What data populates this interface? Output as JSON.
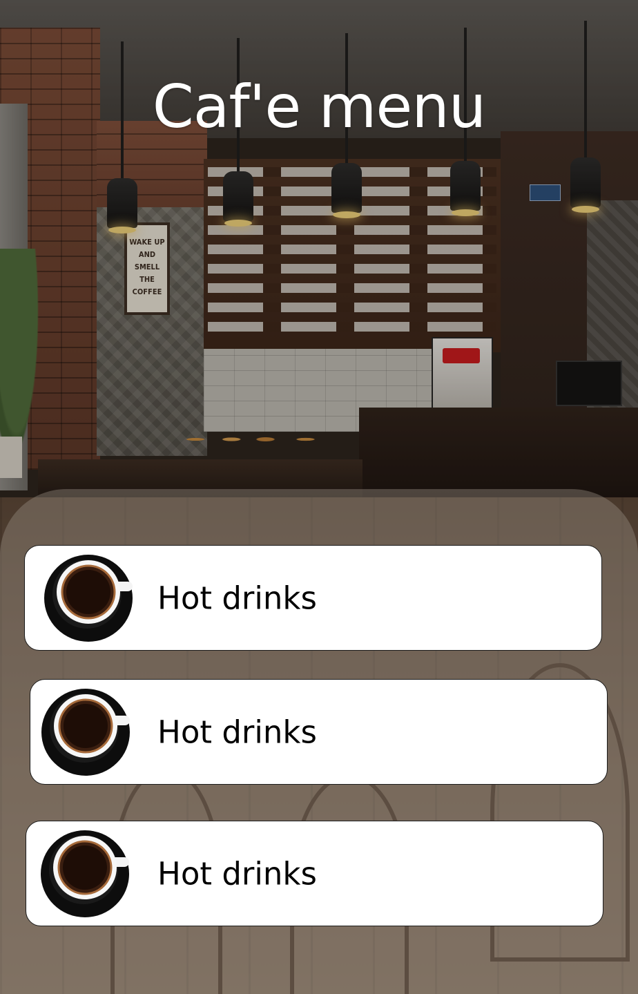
{
  "header": {
    "title": "Caf'e menu"
  },
  "menu": {
    "items": [
      {
        "label": "Hot drinks",
        "icon": "coffee-cup-icon"
      },
      {
        "label": "Hot drinks",
        "icon": "coffee-cup-icon"
      },
      {
        "label": "Hot drinks",
        "icon": "coffee-cup-icon"
      }
    ]
  },
  "colors": {
    "card_background": "#ffffff",
    "title_text": "#ffffff",
    "label_text": "#000000",
    "panel_overlay": "rgba(150,140,128,0.42)"
  }
}
